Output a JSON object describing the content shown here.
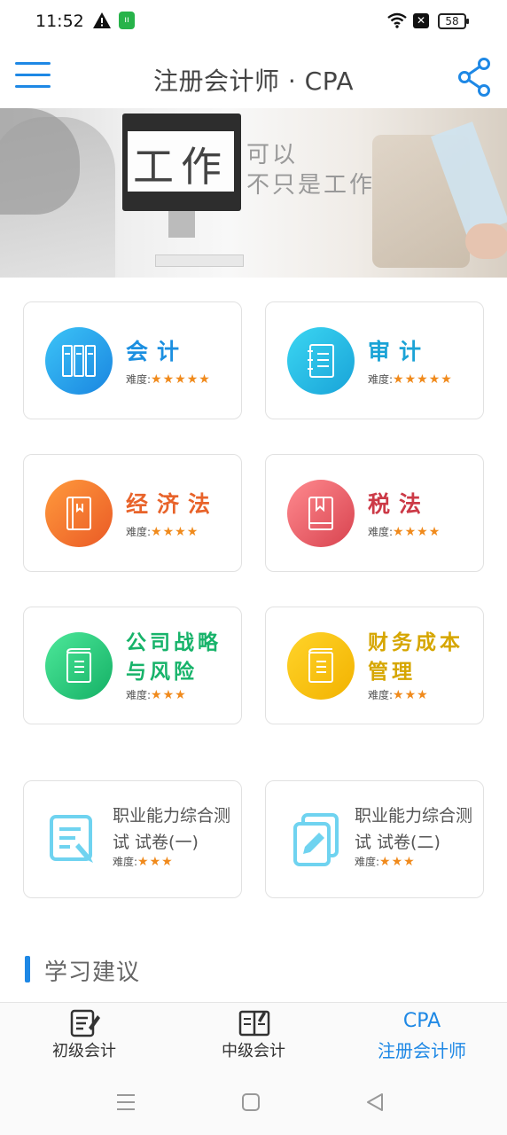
{
  "status": {
    "time": "11:52",
    "battery": "58",
    "app_icon_text": "ıı",
    "sim_icon_text": "✕"
  },
  "header": {
    "title": "注册会计师 · CPA",
    "menu_icon": "menu-icon",
    "share_icon": "share-icon"
  },
  "banner": {
    "big_text": "工作",
    "line1": "可以",
    "line2": "不只是工作"
  },
  "subjects": [
    {
      "name": "会计",
      "difficulty_label": "难度:",
      "stars": "★★★★★",
      "color": "#1b8fe0",
      "icon": "binders-icon"
    },
    {
      "name": "审计",
      "difficulty_label": "难度:",
      "stars": "★★★★★",
      "color": "#1aa3d6",
      "icon": "notebook-icon"
    },
    {
      "name": "经济法",
      "difficulty_label": "难度:",
      "stars": "★★★★",
      "color": "#e8632a",
      "icon": "book-icon"
    },
    {
      "name": "税法",
      "difficulty_label": "难度:",
      "stars": "★★★★",
      "color": "#cc3a47",
      "icon": "bookmark-book-icon"
    },
    {
      "name": "公司战略与风险",
      "difficulty_label": "难度:",
      "stars": "★★★",
      "color": "#17b36a",
      "icon": "green-book-icon"
    },
    {
      "name": "财务成本管理",
      "difficulty_label": "难度:",
      "stars": "★★★",
      "color": "#d6a600",
      "icon": "yellow-book-icon"
    }
  ],
  "tests": [
    {
      "title": "职业能力综合测试 试卷(一)",
      "difficulty_label": "难度:",
      "stars": "★★★",
      "icon": "edit-document-icon"
    },
    {
      "title": "职业能力综合测试 试卷(二)",
      "difficulty_label": "难度:",
      "stars": "★★★",
      "icon": "pencil-document-icon"
    }
  ],
  "section": {
    "title": "学习建议"
  },
  "tabs": [
    {
      "label": "初级会计",
      "top": ""
    },
    {
      "label": "中级会计",
      "top": ""
    },
    {
      "label": "注册会计师",
      "top": "CPA"
    }
  ],
  "colors": {
    "accent": "#1e88e5",
    "star": "#f08a1c"
  }
}
